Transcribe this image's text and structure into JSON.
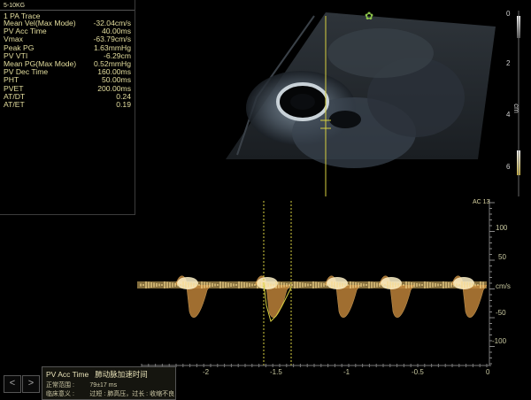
{
  "probe": "5-10KG",
  "trace_title": "1 PA Trace",
  "measurements": [
    {
      "label": "Mean Vel(Max Mode)",
      "value": "-32.04cm/s"
    },
    {
      "label": "PV Acc Time",
      "value": "40.00ms"
    },
    {
      "label": "Vmax",
      "value": "-63.79cm/s"
    },
    {
      "label": "Peak PG",
      "value": "1.63mmHg"
    },
    {
      "label": "PV VTI",
      "value": "-6.29cm"
    },
    {
      "label": "Mean PG(Max Mode)",
      "value": "0.52mmHg"
    },
    {
      "label": "PV Dec Time",
      "value": "160.00ms"
    },
    {
      "label": "PHT",
      "value": "50.00ms"
    },
    {
      "label": "PVET",
      "value": "200.00ms"
    },
    {
      "label": "AT/DT",
      "value": "0.24"
    },
    {
      "label": "AT/ET",
      "value": "0.19"
    }
  ],
  "depth_scale": [
    "0",
    "2",
    "4",
    "6"
  ],
  "depth_unit": "cm",
  "ac_label": "AC 13",
  "velocity_ticks": [
    "100",
    "50",
    "cm/s",
    "-50",
    "-100"
  ],
  "time_ticks": [
    "-2",
    "-1.5",
    "-1",
    "-0.5",
    "0"
  ],
  "tooltip": {
    "title": "PV Acc Time",
    "title_cn": "肺动脉加速时间",
    "range_label": "正常范围 :",
    "range_value": "79±17 ms",
    "meaning_label": "临床意义 :",
    "meaning_value": "过短 : 肺高压，过长 : 收缩不良"
  },
  "nav": {
    "prev": "<",
    "next": ">"
  },
  "colors": {
    "text": "#e4de9e",
    "trace": "#f0c870",
    "caliper": "#d8d040",
    "logo": "#8bc34a"
  }
}
